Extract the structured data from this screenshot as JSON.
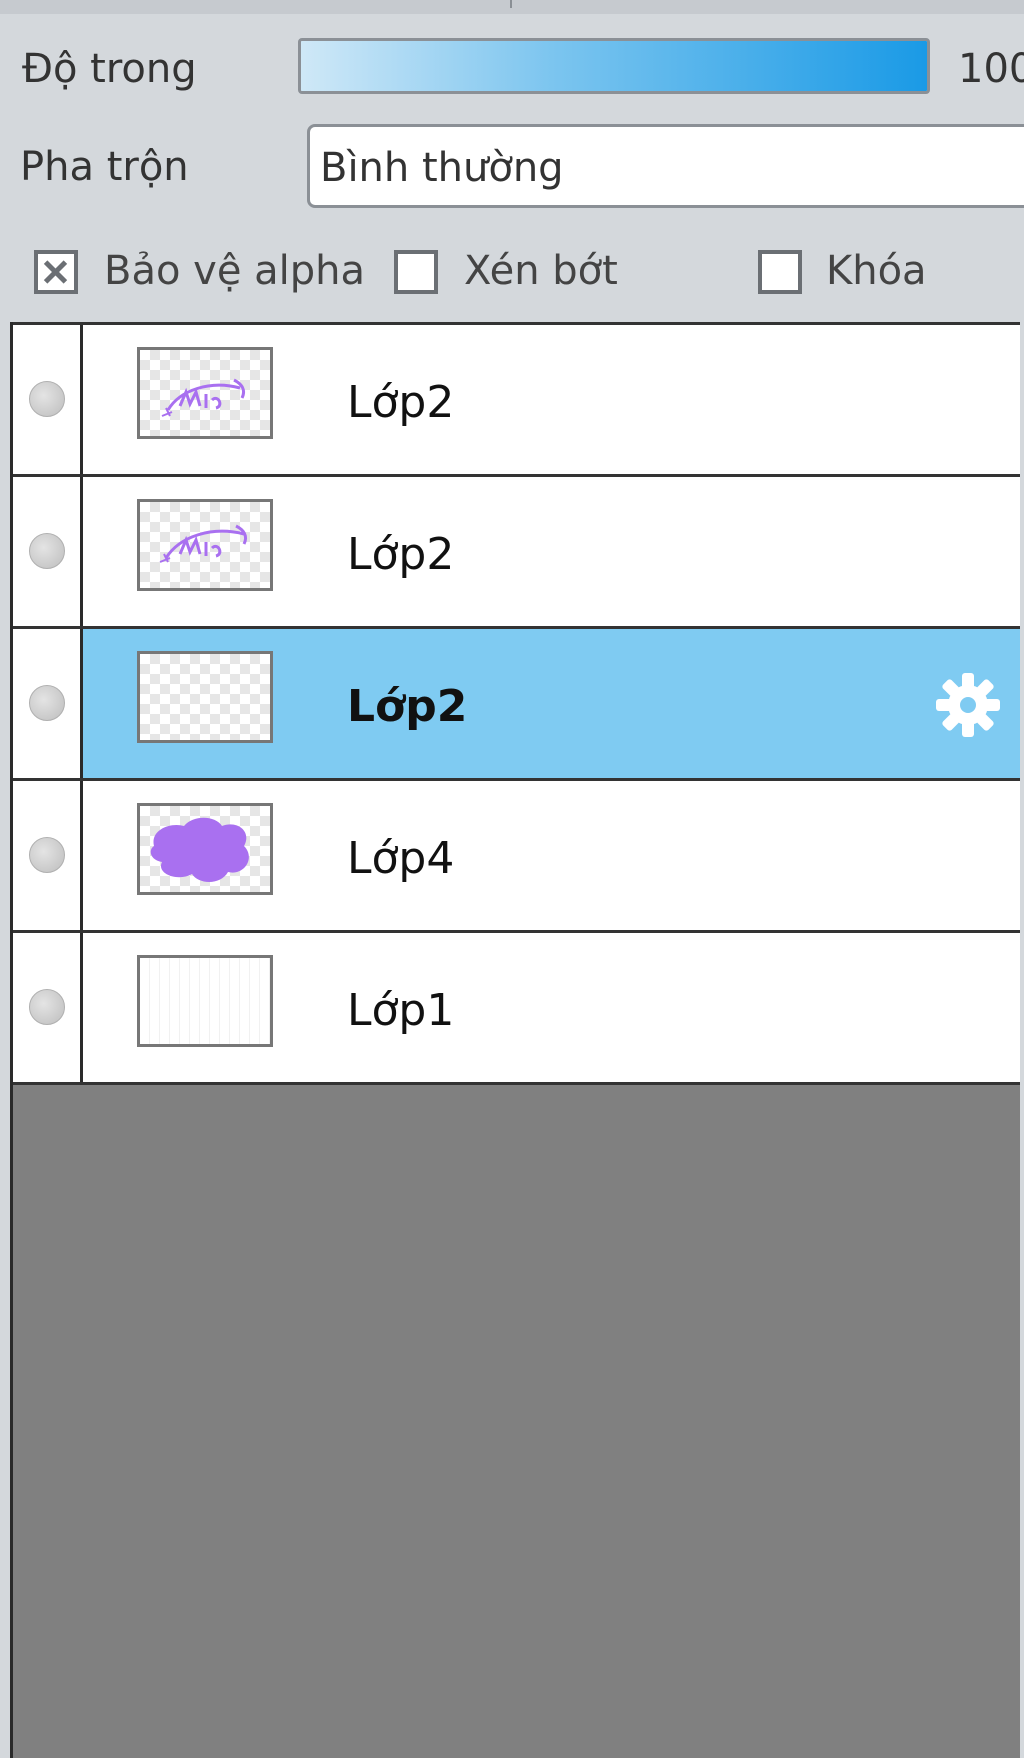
{
  "opacity": {
    "label": "Độ trong",
    "value_text": "100",
    "fill_percent": 100
  },
  "blend": {
    "label": "Pha trộn",
    "selected": "Bình thường"
  },
  "options": [
    {
      "label": "Bảo vệ alpha",
      "checked": true
    },
    {
      "label": "Xén bớt",
      "checked": false
    },
    {
      "label": "Khóa",
      "checked": false
    }
  ],
  "layers": [
    {
      "name": "Lớp2",
      "selected": false,
      "thumbnail": "purple-text-sketch"
    },
    {
      "name": "Lớp2",
      "selected": false,
      "thumbnail": "purple-text-sketch"
    },
    {
      "name": "Lớp2",
      "selected": true,
      "thumbnail": "empty-transparent",
      "settings_icon": "gear-icon"
    },
    {
      "name": "Lớp4",
      "selected": false,
      "thumbnail": "purple-blob"
    },
    {
      "name": "Lớp1",
      "selected": false,
      "thumbnail": "white-background"
    }
  ],
  "colors": {
    "selected_row": "#7fcbf2",
    "opacity_bar": "#1a9ae6",
    "panel_bg": "#d4d8dc",
    "empty_area": "#808080",
    "thumbnail_ink": "#a970f0"
  }
}
